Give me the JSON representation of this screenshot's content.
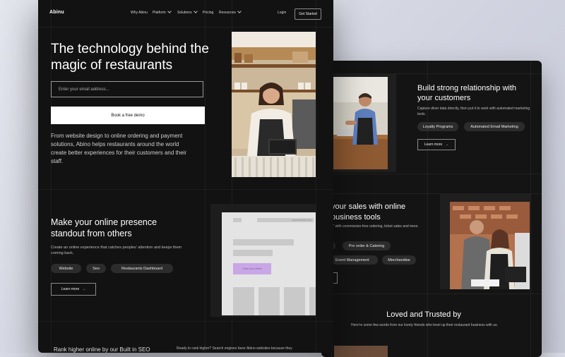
{
  "nav": {
    "logo": "Abinu",
    "items": [
      {
        "label": "Why Abinu",
        "has_menu": false
      },
      {
        "label": "Platform",
        "has_menu": true
      },
      {
        "label": "Solutions",
        "has_menu": true
      },
      {
        "label": "Pricing",
        "has_menu": false
      },
      {
        "label": "Resources",
        "has_menu": true
      }
    ],
    "login": "Login",
    "get_started": "Get Started"
  },
  "hero": {
    "title": "The technology behind the magic of restaurants",
    "email_placeholder": "Enter your email address...",
    "demo_button": "Book a free demo",
    "description": "From website design to online ordering and payment solutions, Abino helps restaurants around the world create better experiences for their customers and their staff."
  },
  "presence": {
    "title": "Make your online presence standout from others",
    "description": "Create an online experience that catches peoples' attention and keeps them coming back.",
    "tags": [
      "Website",
      "Seo",
      "Restaurants Dashboard"
    ],
    "learn_more": "Learn more",
    "mock_url": "www.website.com",
    "mock_button": "Order your dinner"
  },
  "bottom": {
    "left": "Rank higher online by our Built in SEO",
    "right": "Ready to rank higher? Search engines favor Abino websites because they"
  },
  "relationship": {
    "title": "Build strong relationship with your customers",
    "description": "Capture diner data directly, then put it to work with automated marketing tools.",
    "tags": [
      "Loyalty Programs",
      "Automated Email Marketing"
    ],
    "learn_more": "Learn more"
  },
  "sales": {
    "title": "your sales with online business tools",
    "description": "y\" with commission-free ordering, ticket sales and more.",
    "tags": [
      "Pre order & Catering",
      "Event Management",
      "Merchandise"
    ]
  },
  "trusted": {
    "title": "Loved and Trusted by",
    "description": "Here're some few words from our lovely friends who level up their restaurant business with us."
  },
  "colors": {
    "page_bg": "#121212",
    "pill_bg": "#2c2c2c",
    "mock_button": "#c9a6e6"
  }
}
